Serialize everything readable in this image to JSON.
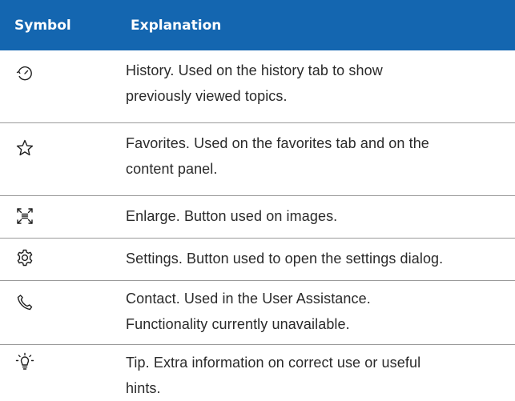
{
  "table": {
    "headers": {
      "symbol": "Symbol",
      "explanation": "Explanation"
    },
    "rows": [
      {
        "icon": "history-icon",
        "line1": "History. Used on the history tab to show",
        "line2": "previously viewed topics."
      },
      {
        "icon": "star-icon",
        "line1": "Favorites. Used on the favorites tab and on the",
        "line2": "content panel."
      },
      {
        "icon": "enlarge-icon",
        "line1": "Enlarge. Button used on images.",
        "line2": ""
      },
      {
        "icon": "gear-icon",
        "line1": "Settings. Button used to open the settings dialog.",
        "line2": ""
      },
      {
        "icon": "phone-icon",
        "line1": "Contact. Used in the User Assistance.",
        "line2": "Functionality currently unavailable."
      },
      {
        "icon": "lightbulb-icon",
        "line1": "Tip. Extra information on correct use or useful",
        "line2": "hints."
      }
    ]
  },
  "colors": {
    "header_bg": "#1466b0",
    "header_text": "#ffffff",
    "divider": "#9a9a9a"
  }
}
